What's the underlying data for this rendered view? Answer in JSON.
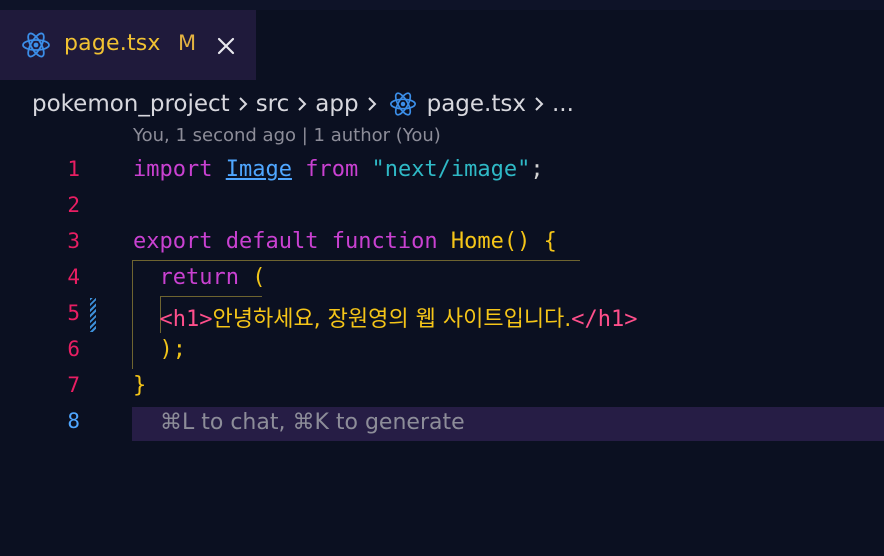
{
  "tab": {
    "filename": "page.tsx",
    "status": "M",
    "icon": "react-icon",
    "close_icon": "close-icon"
  },
  "breadcrumb": {
    "items": [
      "pokemon_project",
      "src",
      "app",
      "page.tsx",
      "..."
    ]
  },
  "blame": "You, 1 second ago | 1 author (You)",
  "lines": [
    {
      "num": "1"
    },
    {
      "num": "2"
    },
    {
      "num": "3"
    },
    {
      "num": "4"
    },
    {
      "num": "5"
    },
    {
      "num": "6"
    },
    {
      "num": "7"
    },
    {
      "num": "8"
    }
  ],
  "code": {
    "l1": {
      "import": "import",
      "name": "Image",
      "from": "from",
      "path": "\"next/image\"",
      "semi": ";"
    },
    "l3": {
      "export": "export",
      "default": "default",
      "function": "function",
      "name": "Home",
      "parens": "()",
      "brace": " {"
    },
    "l4": {
      "return": "return",
      "paren": " ("
    },
    "l5": {
      "open": "<h1>",
      "text": "안녕하세요, 장원영의 웹 사이트입니다.",
      "close": "</h1>"
    },
    "l6": {
      "close": ");"
    },
    "l7": {
      "brace": "}"
    }
  },
  "chat_hint": "⌘L to chat, ⌘K to generate",
  "colors": {
    "background": "#0b1021",
    "tab_active": "#1f1a3b",
    "keyword": "#c941d1",
    "string": "#2fb9c6",
    "function": "#f5c518",
    "line_number": "#e91e63",
    "current_line_number": "#4fa6ff"
  }
}
